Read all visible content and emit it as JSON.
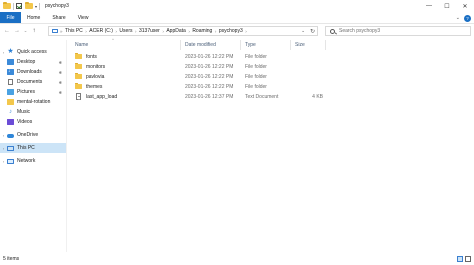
{
  "window": {
    "title": "psychopy3",
    "controls": {
      "minimize": "—",
      "maximize": "☐",
      "close": "✕"
    }
  },
  "quick_access_icons": [
    "folder-icon",
    "checkmark-properties-icon",
    "folder-new-icon",
    "customize-dropdown-icon"
  ],
  "ribbon": {
    "file_label": "File",
    "tabs": [
      "Home",
      "Share",
      "View"
    ],
    "expand_glyph": "⌄",
    "help_glyph": "?",
    "accent_color": "#1a6fc4"
  },
  "navigation": {
    "back": "←",
    "forward": "→",
    "recent": "⌄",
    "up": "↑"
  },
  "address": {
    "root_glyph": "»",
    "crumbs": [
      "This PC",
      "ACER (C:)",
      "Users",
      "3137user",
      "AppData",
      "Roaming",
      "psychopy3"
    ],
    "dropdown_glyph": "⌄",
    "refresh_glyph": "↻"
  },
  "search": {
    "placeholder": "Search psychopy3"
  },
  "sidebar": {
    "items": [
      {
        "label": "Quick access",
        "icon": "star-icon",
        "pinned": false,
        "caret": "›"
      },
      {
        "label": "Desktop",
        "icon": "desktop-icon",
        "pinned": true
      },
      {
        "label": "Downloads",
        "icon": "downloads-icon",
        "pinned": true
      },
      {
        "label": "Documents",
        "icon": "documents-icon",
        "pinned": true
      },
      {
        "label": "Pictures",
        "icon": "pictures-icon",
        "pinned": true
      },
      {
        "label": "mental-rotation",
        "icon": "folder-icon",
        "pinned": false
      },
      {
        "label": "Music",
        "icon": "music-icon",
        "pinned": false
      },
      {
        "label": "Videos",
        "icon": "videos-icon",
        "pinned": false
      },
      {
        "label": "OneDrive",
        "icon": "onedrive-icon",
        "pinned": false,
        "caret": "›"
      },
      {
        "label": "This PC",
        "icon": "this-pc-icon",
        "pinned": false,
        "caret": "›",
        "selected": true
      },
      {
        "label": "Network",
        "icon": "network-icon",
        "pinned": false,
        "caret": "›"
      }
    ],
    "pin_glyph": "✱",
    "selected_color": "#cce4f7"
  },
  "file_list": {
    "columns": [
      "Name",
      "Date modified",
      "Type",
      "Size"
    ],
    "sort_glyph": "^",
    "rows": [
      {
        "name": "fonts",
        "date": "2023-01-26 12:22 PM",
        "type": "File folder",
        "size": "",
        "icon": "folder-icon"
      },
      {
        "name": "monitors",
        "date": "2023-01-26 12:22 PM",
        "type": "File folder",
        "size": "",
        "icon": "folder-icon"
      },
      {
        "name": "pavlovia",
        "date": "2023-01-26 12:22 PM",
        "type": "File folder",
        "size": "",
        "icon": "folder-icon"
      },
      {
        "name": "themes",
        "date": "2023-01-26 12:22 PM",
        "type": "File folder",
        "size": "",
        "icon": "folder-icon"
      },
      {
        "name": "last_app_load",
        "date": "2023-01-26 12:37 PM",
        "type": "Text Document",
        "size": "4 KB",
        "icon": "text-document-icon"
      }
    ]
  },
  "status": {
    "item_count": "5 items"
  }
}
